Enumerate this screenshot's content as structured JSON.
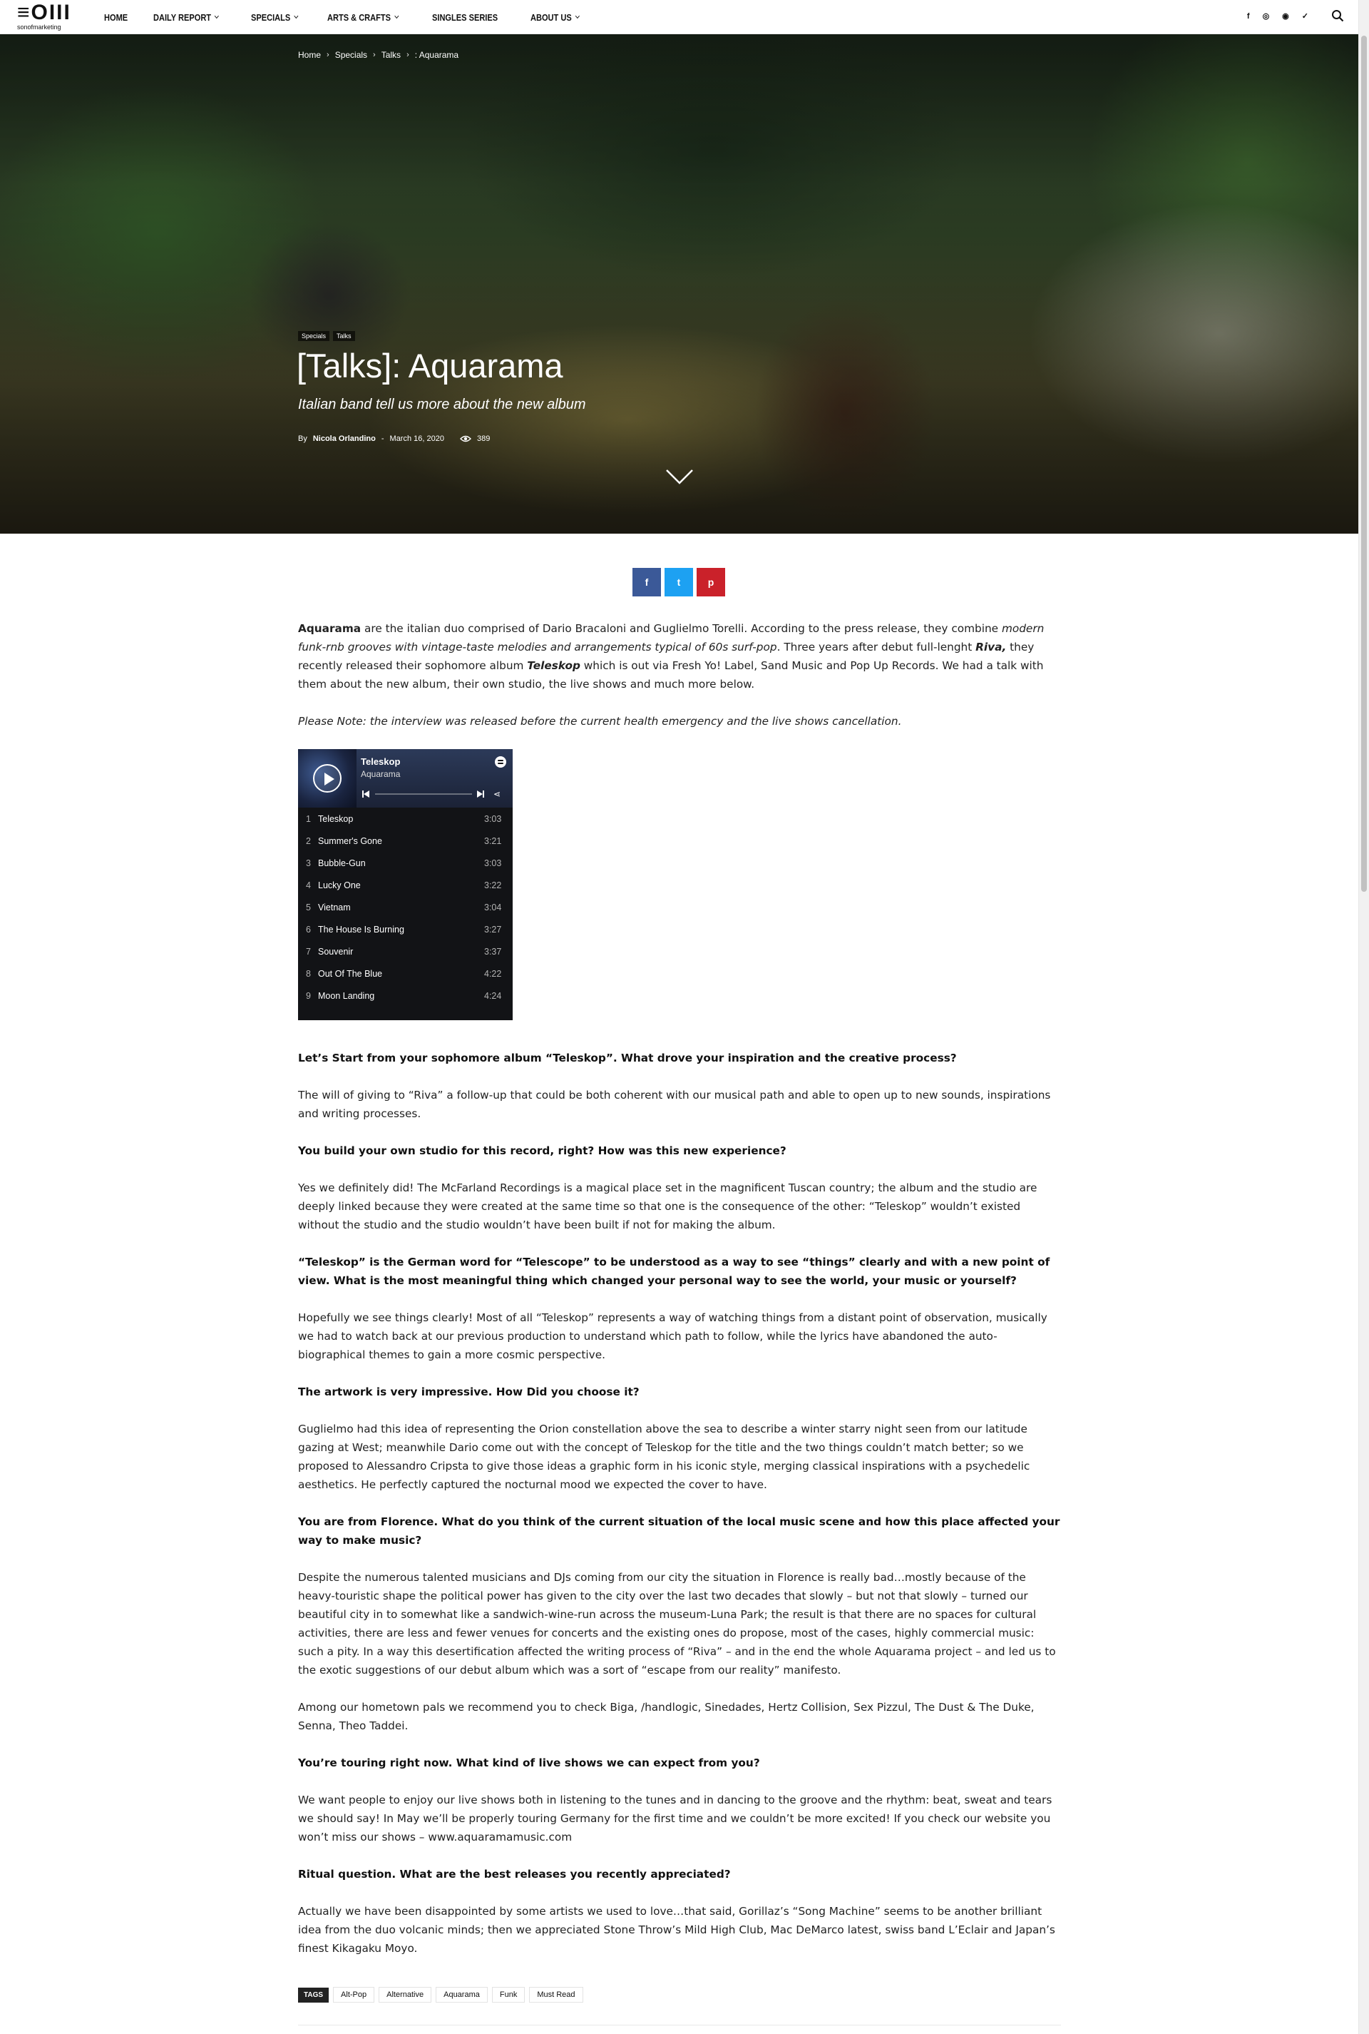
{
  "nav": {
    "logo_text": "≡OIII",
    "logo_sub": "sonofmarketing",
    "items": [
      {
        "label": "HOME",
        "has_dropdown": false
      },
      {
        "label": "DAILY REPORT",
        "has_dropdown": true
      },
      {
        "label": "SPECIALS",
        "has_dropdown": true
      },
      {
        "label": "ARTS & CRAFTS",
        "has_dropdown": true
      },
      {
        "label": "SINGLES SERIES",
        "has_dropdown": false
      },
      {
        "label": "ABOUT US",
        "has_dropdown": true
      }
    ],
    "social": [
      "f",
      "◎",
      "◉",
      "✓"
    ],
    "social_icons": [
      "facebook-icon",
      "instagram-icon",
      "reddit-icon",
      "twitter-icon"
    ]
  },
  "hero": {
    "breadcrumb": [
      "Home",
      "Specials",
      "Talks",
      ": Aquarama"
    ],
    "categories": [
      "Specials",
      "Talks"
    ],
    "title": "[Talks]: Aquarama",
    "subtitle": "Italian band tell us more about the new album",
    "by": "By",
    "author": "Nicola Orlandino",
    "date": "March 16, 2020",
    "views": "389"
  },
  "share": {
    "facebook": "f",
    "twitter": "t",
    "pinterest": "p"
  },
  "article": {
    "intro": {
      "b1": "Aquarama",
      "t1": " are the italian duo comprised of Dario Bracaloni and Guglielmo Torelli. According to the press release, they combine ",
      "i1": "modern funk-rnb grooves with vintage-taste melodies and arrangements typical of 60s surf-pop",
      "t2": ". Three years after debut full-lenght ",
      "bi1": "Riva,",
      "t3": " they recently released their sophomore album ",
      "bi2": "Teleskop",
      "t4": " which is out via Fresh Yo! Label, Sand Music and Pop Up Records. We had a talk with them about the new album, their own studio, the live shows and much more below."
    },
    "note": "Please Note: the interview was released before the current health emergency and the live shows cancellation.",
    "qa": [
      {
        "q": "Let’s Start from your sophomore album “Teleskop”. What drove your inspiration and the creative process?",
        "a": [
          "The will of giving to “Riva” a follow-up that could be both coherent with our musical path and able to open up to new sounds, inspirations and writing processes."
        ]
      },
      {
        "q": "You build your own studio for this record, right? How was this new experience?",
        "a": [
          "Yes we definitely did! The McFarland Recordings is a magical place set in the magnificent Tuscan country; the album and the studio are deeply linked because they were created at the same time so that one is the consequence of the other: “Teleskop” wouldn’t existed without the studio and the studio wouldn’t have been built if not for making the album."
        ]
      },
      {
        "q": "“Teleskop” is the German word for “Telescope” to be understood as a way to see “things” clearly and with a new point of view. What is the most meaningful thing which changed your personal way to see the world, your music or yourself?",
        "a": [
          "Hopefully we see things clearly! Most of all “Teleskop” represents a way of watching things from a distant point of observation, musically we had to watch back at our previous production to understand which path to follow, while the lyrics have abandoned the auto-biographical themes to gain a more cosmic perspective."
        ]
      },
      {
        "q": "The artwork is very impressive. How Did you choose it?",
        "a": [
          "Guglielmo had this idea of representing the Orion constellation above the sea to describe a winter starry night seen from our latitude gazing at West; meanwhile Dario come out with the concept of Teleskop for the title and the two things couldn’t match better; so we proposed to Alessandro Cripsta to give those ideas a graphic form in his iconic style, merging classical inspirations with a psychedelic aesthetics. He perfectly captured the nocturnal mood we expected the cover to have."
        ]
      },
      {
        "q": "You are from Florence. What do you think of the current situation of the local music scene and how this place affected your way to make music?",
        "a": [
          "Despite the numerous talented musicians and DJs coming from our city the situation in Florence is really bad…mostly because of the heavy-touristic shape the political power has given to the city over the last two decades that slowly – but not that slowly – turned our beautiful city in to somewhat like a sandwich-wine-run across the museum-Luna Park; the result is that there are no spaces for cultural activities, there are less and fewer venues for concerts and the existing ones do propose, most of the cases, highly commercial music: such a pity. In a way this desertification affected the writing process of “Riva” – and in the end the whole Aquarama project – and led us to the exotic suggestions of our debut album which was a sort of “escape from our reality” manifesto.",
          "Among our hometown pals we recommend you to check Biga, /handlogic, Sinedades, Hertz Collision, Sex Pizzul, The Dust & The Duke, Senna, Theo Taddei."
        ]
      },
      {
        "q": "You’re touring right now. What kind of live shows we can expect from you?",
        "a": [
          "We want people to enjoy our live shows both in listening to the tunes and in dancing to the groove and the rhythm: beat, sweat and tears we should say! In May we’ll be properly touring Germany for the first time and we couldn’t be more excited! If you check our website you won’t miss our shows – www.aquaramamusic.com"
        ]
      },
      {
        "q": "Ritual question. What are the best releases you recently appreciated?",
        "a": [
          "Actually we have been disappointed by some artists we used to love…that said, Gorillaz’s “Song Machine” seems to be another brilliant idea from the duo volcanic minds; then we appreciated Stone Throw’s Mild High Club, Mac DeMarco latest, swiss band L’Eclair and Japan’s finest Kikagaku Moyo."
        ]
      }
    ]
  },
  "player": {
    "album": "Teleskop",
    "artist": "Aquarama",
    "tracks": [
      {
        "n": "1",
        "name": "Teleskop",
        "dur": "3:03"
      },
      {
        "n": "2",
        "name": "Summer's Gone",
        "dur": "3:21"
      },
      {
        "n": "3",
        "name": "Bubble-Gun",
        "dur": "3:03"
      },
      {
        "n": "4",
        "name": "Lucky One",
        "dur": "3:22"
      },
      {
        "n": "5",
        "name": "Vietnam",
        "dur": "3:04"
      },
      {
        "n": "6",
        "name": "The House Is Burning",
        "dur": "3:27"
      },
      {
        "n": "7",
        "name": "Souvenir",
        "dur": "3:37"
      },
      {
        "n": "8",
        "name": "Out Of The Blue",
        "dur": "4:22"
      },
      {
        "n": "9",
        "name": "Moon Landing",
        "dur": "4:24"
      }
    ]
  },
  "tags": {
    "label": "TAGS",
    "items": [
      "Alt-Pop",
      "Alternative",
      "Aquarama",
      "Funk",
      "Must Read"
    ]
  },
  "colors": {
    "facebook": "#3b5998",
    "twitter": "#1da1f2",
    "pinterest": "#ca212a"
  }
}
